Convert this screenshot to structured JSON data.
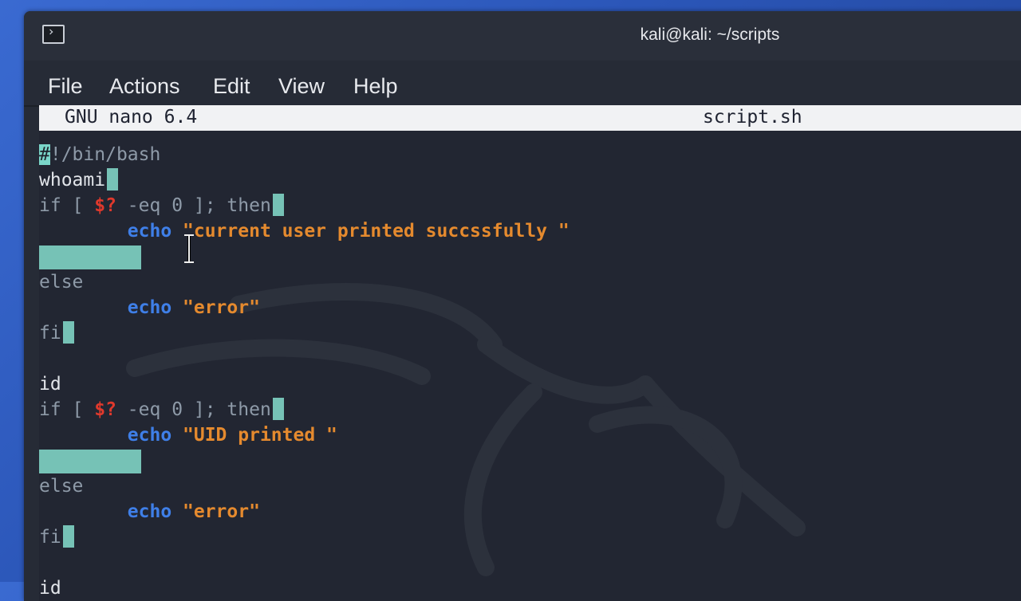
{
  "window": {
    "title": "kali@kali: ~/scripts",
    "icon": "terminal-icon"
  },
  "menu": [
    "File",
    "Actions",
    "Edit",
    "View",
    "Help"
  ],
  "nano": {
    "version": "GNU nano 6.4",
    "filename": "script.sh"
  },
  "code": {
    "shebang_first": "#",
    "shebang_rest": "!/bin/bash",
    "l2": "whoami",
    "if_a": "if [ ",
    "var": "$?",
    "if_b": " -eq 0 ]; then",
    "indent": "        ",
    "echo": "echo",
    "str1": " \"current user printed succssfully \"",
    "else": "else",
    "str_err": " \"error\"",
    "fi": "fi",
    "id": "id",
    "str2": " \"UID printed \""
  },
  "colors": {
    "keyword": "#8e9aa8",
    "variable": "#e0392c",
    "echo": "#3f7fe8",
    "string": "#e58a2e",
    "whitespace_highlight": "#76c2b6"
  }
}
